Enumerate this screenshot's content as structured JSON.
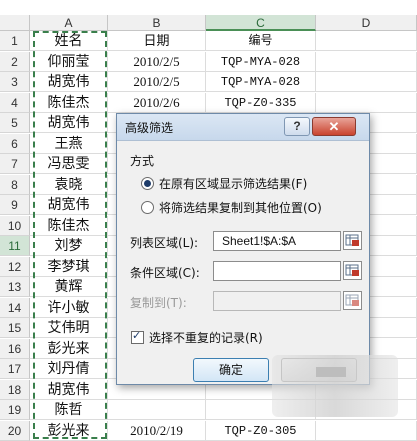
{
  "columns": [
    "A",
    "B",
    "C",
    "D"
  ],
  "selected_column": "C",
  "rows": [
    {
      "num": "1",
      "a": "姓名",
      "b": "日期",
      "c": "编号"
    },
    {
      "num": "2",
      "a": "仰丽莹",
      "b": "2010/2/5",
      "c": "TQP-MYA-028"
    },
    {
      "num": "3",
      "a": "胡宽伟",
      "b": "2010/2/5",
      "c": "TQP-MYA-028"
    },
    {
      "num": "4",
      "a": "陈佳杰",
      "b": "2010/2/6",
      "c": "TQP-Z0-335"
    },
    {
      "num": "5",
      "a": "胡宽伟",
      "b": "",
      "c": ""
    },
    {
      "num": "6",
      "a": "王燕",
      "b": "",
      "c": ""
    },
    {
      "num": "7",
      "a": "冯思雯",
      "b": "",
      "c": ""
    },
    {
      "num": "8",
      "a": "袁晓",
      "b": "",
      "c": ""
    },
    {
      "num": "9",
      "a": "胡宽伟",
      "b": "",
      "c": ""
    },
    {
      "num": "10",
      "a": "陈佳杰",
      "b": "",
      "c": ""
    },
    {
      "num": "11",
      "a": "刘梦",
      "b": "",
      "c": ""
    },
    {
      "num": "12",
      "a": "李梦琪",
      "b": "",
      "c": ""
    },
    {
      "num": "13",
      "a": "黄辉",
      "b": "",
      "c": ""
    },
    {
      "num": "14",
      "a": "许小敏",
      "b": "",
      "c": ""
    },
    {
      "num": "15",
      "a": "艾伟明",
      "b": "",
      "c": ""
    },
    {
      "num": "16",
      "a": "彭光来",
      "b": "",
      "c": ""
    },
    {
      "num": "17",
      "a": "刘丹倩",
      "b": "",
      "c": ""
    },
    {
      "num": "18",
      "a": "胡宽伟",
      "b": "",
      "c": ""
    },
    {
      "num": "19",
      "a": "陈哲",
      "b": "",
      "c": ""
    },
    {
      "num": "20",
      "a": "彭光来",
      "b": "2010/2/19",
      "c": "TQP-Z0-305"
    }
  ],
  "selected_row": "11",
  "dialog": {
    "title": "高级筛选",
    "help_label": "?",
    "close_label": "✕",
    "section_label": "方式",
    "radio_inplace": "在原有区域显示筛选结果(F)",
    "radio_copy": "将筛选结果复制到其他位置(O)",
    "selected_mode": "inplace",
    "list_range_label": "列表区域(L):",
    "list_range_value": "Sheet1!$A:$A",
    "criteria_label": "条件区域(C):",
    "criteria_value": "",
    "copy_to_label": "复制到(T):",
    "copy_to_value": "",
    "unique_label": "选择不重复的记录(R)",
    "unique_checked": true,
    "ok_label": "确定"
  },
  "colors": {
    "selected_header": "#d2e4d6",
    "marquee": "#3a7f4c",
    "dialog_bg": "#f0f0f0",
    "close_button": "#c9432e"
  }
}
